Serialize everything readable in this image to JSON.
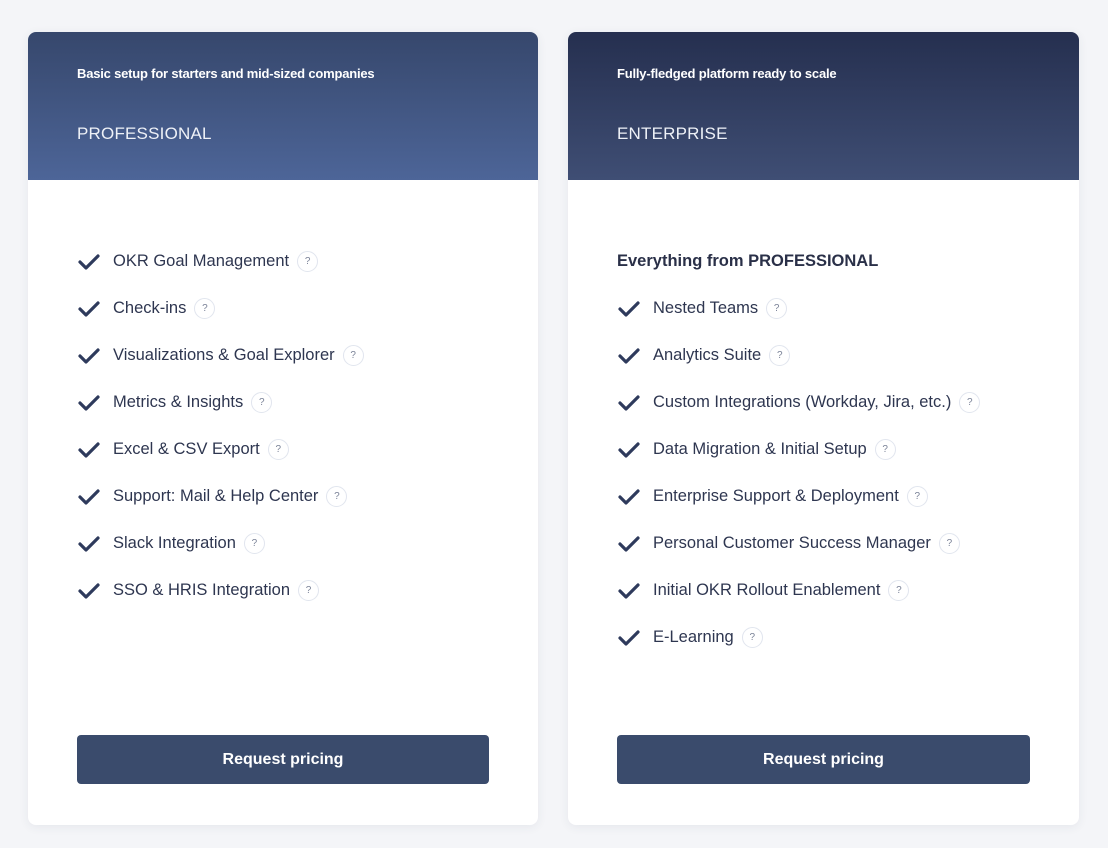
{
  "plans": [
    {
      "tagline": "Basic setup for starters and mid-sized companies",
      "name": "PROFESSIONAL",
      "intro": null,
      "features": [
        "OKR Goal Management",
        "Check-ins",
        "Visualizations & Goal Explorer",
        "Metrics & Insights",
        "Excel & CSV Export",
        "Support: Mail & Help Center",
        "Slack Integration",
        "SSO & HRIS Integration"
      ],
      "cta_label": "Request pricing"
    },
    {
      "tagline": "Fully-fledged platform ready to scale",
      "name": "ENTERPRISE",
      "intro": "Everything from PROFESSIONAL",
      "features": [
        "Nested Teams",
        "Analytics Suite",
        "Custom Integrations (Workday, Jira, etc.)",
        "Data Migration & Initial Setup",
        "Enterprise Support & Deployment",
        "Personal Customer Success Manager",
        "Initial OKR Rollout Enablement",
        "E-Learning"
      ],
      "cta_label": "Request pricing"
    }
  ],
  "help_glyph": "?",
  "icons": {
    "feature_marker": "check-icon",
    "help": "help-icon"
  },
  "colors": {
    "button": "#3a4b6c",
    "check": "#2e3a5c",
    "pro_header": "#4d6598",
    "ent_header": "#2f3b5e"
  }
}
